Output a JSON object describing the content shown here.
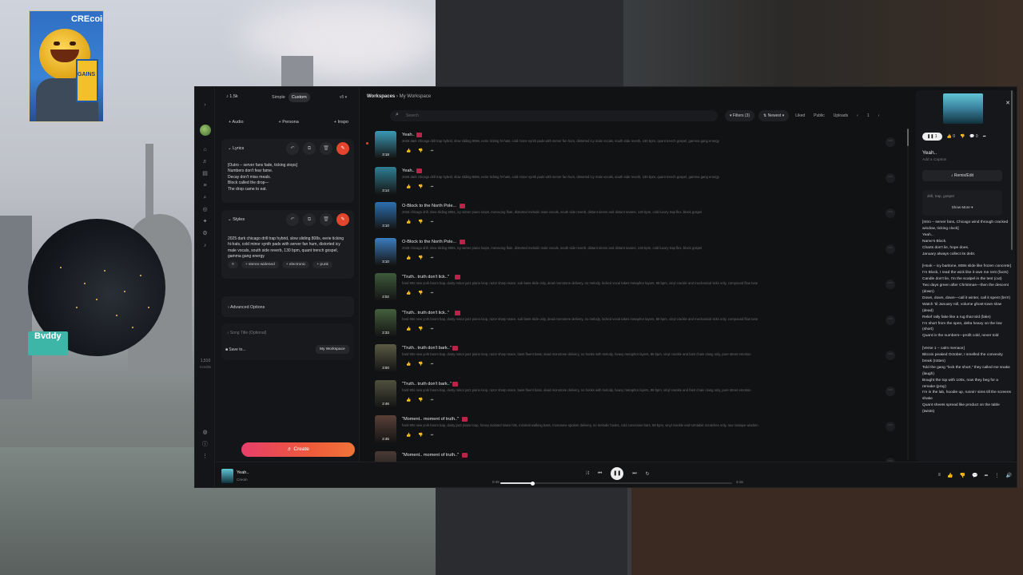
{
  "overlay": {
    "poster_brand": "CREcoin",
    "poster_can_text": "GAINS",
    "buddy_label": "Bvddy"
  },
  "rail": {
    "credits_value": "1,510",
    "credits_label": "Credits"
  },
  "create": {
    "count": "1.5k",
    "mode_simple": "Simple",
    "mode_custom": "Custom",
    "version": "v5",
    "add_audio": "+ Audio",
    "add_persona": "+ Persona",
    "add_inspo": "+ Inspo",
    "lyrics_header": "Lyrics",
    "lyrics_text": "[Outro – server fans fade, ticking stops]\nNumbers don't fear fame.\nDecay don't miss meals.\nBlock called the drop—\nThe drop came to eat.",
    "styles_header": "Styles",
    "styles_text": "2025 dark chicago drill trap hybrid, slow sliding 808s, eerie ticking hi-hats, cold minor synth pads with server fan hum, distorted icy male vocals, south side reverb, 130 bpm, quant trench gospel, gamma gang energy",
    "chips": [
      "≡",
      "+ stereo-widened",
      "+ electronic",
      "+ punk"
    ],
    "advanced_options": "Advanced Options",
    "song_title_placeholder": "Song Title (Optional)",
    "save_to": "Save to...",
    "workspace_pill": "My Workspace",
    "create_button": "Create"
  },
  "main": {
    "crumb_root": "Workspaces",
    "crumb_current": "My Workspace",
    "search_placeholder": "Search",
    "filters_label": "Filters (3)",
    "sort_label": "Newest",
    "liked": "Liked",
    "public": "Public",
    "uploads": "Uploads",
    "page": "1",
    "songs": [
      {
        "title": "Yeah..",
        "dur": "3:18",
        "desc": "2025 dark chicago drill trap hybrid, slow sliding 808s, eerie ticking hi-hats, cold minor synth pads with server fan hum, distorted icy male vocals, south side reverb, 130 bpm, quant trench gospel, gamma gang energy",
        "color": "#3a9ab5"
      },
      {
        "title": "Yeah..",
        "dur": "3:14",
        "desc": "2025 dark chicago drill trap hybrid, slow sliding 808s, eerie ticking hi-hats, cold minor synth pads with server fan hum, distorted icy male vocals, south side reverb, 130 bpm, quant trench gospel, gamma gang energy",
        "color": "#2f7f94"
      },
      {
        "title": "O-Block to the North Pole...",
        "dur": "3:10",
        "desc": "2025 chicago drill, slow sliding 808s, icy winter piano loops, menacing flute, distorted melodic male vocals, south side reverb, distant sirens and distant snares, 130 bpm, cold luxury trap flex, block gospel",
        "color": "#2c6fb0"
      },
      {
        "title": "O-Block to the North Pole...",
        "dur": "3:10",
        "desc": "2025 chicago drill, slow sliding 808s, icy winter piano loops, menacing flute, distorted melodic male vocals, south side reverb, distant sirens and distant snares, 130 bpm, cold luxury trap flex, block gospel",
        "color": "#3a7dc0"
      },
      {
        "title": "\"Truth.. truth don't lick..\"",
        "dur": "2:02",
        "desc": "hard 90s new york boom bap, dusty minor jazz piano loop, razor sharp snare, sub bass slide only, dead monotone delivery, no melody, locked vocal takes metaphor layers, 88 bpm, vinyl crackle and mechanical ticks only, compound flow tone",
        "color": "#3d5a3a"
      },
      {
        "title": "\"Truth.. truth don't lick..\"",
        "dur": "2:33",
        "desc": "hard 90s new york boom bap, dusty minor jazz piano loop, razor sharp snare, sub bass slide only, dead monotone delivery, no melody, locked vocal takes metaphor layers, 88 bpm, vinyl crackle and mechanical ticks only, compound flow tone",
        "color": "#445f3c"
      },
      {
        "title": "\"Truth.. truth don't bark..\"",
        "dur": "3:00",
        "desc": "hard 90s new york boom bap, dusty minor jazz piano loop, razor sharp snare, bass fluent bass, dead monotone delivery, no hooks with melody, heavy metaphor layers, 88 bpm, vinyl crackle and faint chain clang only, pure street emotion",
        "color": "#5a5a45"
      },
      {
        "title": "\"Truth.. truth don't bark..\"",
        "dur": "2:46",
        "desc": "hard 90s new york boom bap, dusty minor jazz piano loop, razor sharp snare, bass fluent bass, dead monotone delivery, no hooks with melody, heavy metaphor layers, 88 bpm, vinyl crackle and faint chain clang only, pure street emotion",
        "color": "#50503f"
      },
      {
        "title": "\"Moment.. moment of truth..\"",
        "dur": "2:45",
        "desc": "hard 90s new york boom bap, dusty jazz piano loop, heavy isolated snare hits, minimal walking bass, monotone spoken delivery, no melodic hooks, cold conscious bars, 88 bpm, vinyl crackle and turntable scratches only, raw mixtape wisdom",
        "color": "#5a4038"
      },
      {
        "title": "\"Moment.. moment of truth..\"",
        "dur": "",
        "desc": "",
        "color": "#4a3a34"
      }
    ]
  },
  "details": {
    "plays": "1",
    "likes": "0",
    "comments": "0",
    "title": "Yeah..",
    "caption": "Add a Caption",
    "remix": "Remix/Edit",
    "tags": "drill, trap, gospel",
    "show_more": "Show More",
    "lyrics": "[Intro – server fans, Chicago wind through cracked window, ticking clock]\nYeah...\nName's Block.\nCharts don't lie, hope does.\nJanuary always collect its debt.\n\n[Hook – icy baritone, 808s slide like frozen concrete]\nI'm Block, I read the wick like it owe me rent (facts)\nCandle don't lie, I'm the scalpel in the tent (cut)\nTwo days green after Christmas—then the descent (down)\nDown, down, down—call it winter, call it spent (brrr!)\nWatch 'til January roll, volume ghost-town slow (dead)\nRelief rally fake like a rug that told (fake)\nI'm short from the open, delta heavy on the low (short)\nQuant in the numbers—profit cold, never told\n\n[Verse 1 – calm menace]\nBitcoin peaked October, I smelled the convexity break (rotten)\nTold the gang \"lock the short,\" they called me snake (laugh)\nBought the top with 100x, now they beg for a remake (pray)\nI'm in the lab, hoodie up, runnin' sims till the screens shake\nQuant sheets spread like product on the table (twists)"
  },
  "player": {
    "title": "Yeah..",
    "artist": "Creoin",
    "time_elapsed": "0:45",
    "time_total": "3:18",
    "progress": 0.14
  }
}
